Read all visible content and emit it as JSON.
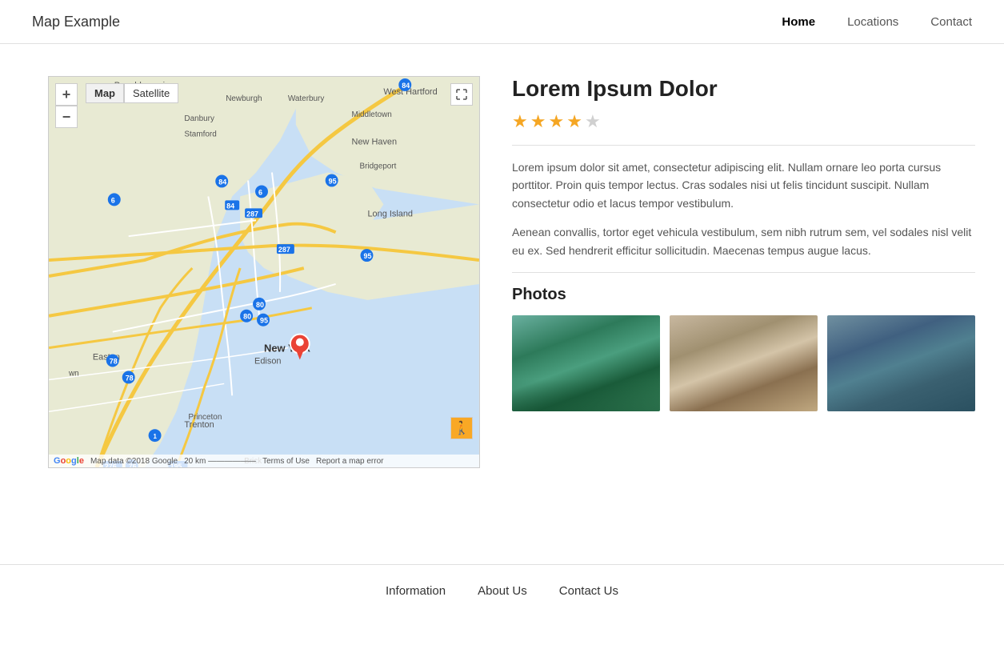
{
  "app": {
    "logo": "Map Example"
  },
  "nav": {
    "links": [
      {
        "label": "Home",
        "active": true
      },
      {
        "label": "Locations",
        "active": false
      },
      {
        "label": "Contact",
        "active": false
      }
    ]
  },
  "map": {
    "zoom_in_label": "+",
    "zoom_out_label": "−",
    "type_map_label": "Map",
    "type_satellite_label": "Satellite",
    "footer_data": "Map data ©2018 Google",
    "footer_scale": "20 km",
    "footer_terms": "Terms of Use",
    "footer_report": "Report a map error",
    "expand_icon": "⤢",
    "person_icon": "🚶"
  },
  "content": {
    "title": "Lorem Ipsum Dolor",
    "stars_filled": 4,
    "stars_total": 5,
    "paragraph1": "Lorem ipsum dolor sit amet, consectetur adipiscing elit. Nullam ornare leo porta cursus porttitor. Proin quis tempor lectus. Cras sodales nisi ut felis tincidunt suscipit. Nullam consectetur odio et lacus tempor vestibulum.",
    "paragraph2": "Aenean convallis, tortor eget vehicula vestibulum, sem nibh rutrum sem, vel sodales nisl velit eu ex. Sed hendrerit efficitur sollicitudin. Maecenas tempus augue lacus.",
    "photos_title": "Photos"
  },
  "footer": {
    "links": [
      {
        "label": "Information"
      },
      {
        "label": "About Us"
      },
      {
        "label": "Contact Us"
      }
    ]
  }
}
